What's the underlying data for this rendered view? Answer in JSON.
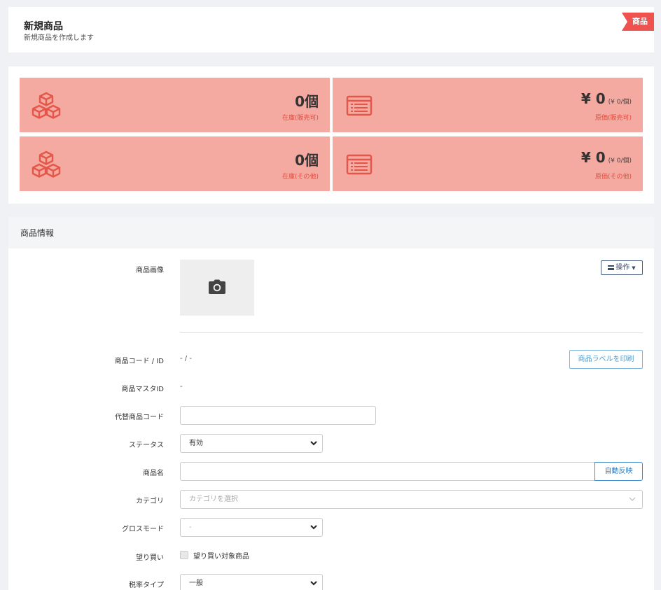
{
  "header": {
    "title": "新規商品",
    "subtitle": "新規商品を作成します",
    "ribbon": "商品"
  },
  "stats": [
    {
      "value": "0個",
      "unit_note": "",
      "label": "在庫(販売可)",
      "icon": "cubes-icon"
    },
    {
      "value": "¥ 0",
      "unit_note": "(¥ 0/個)",
      "label": "原価(販売可)",
      "icon": "card-list-icon"
    },
    {
      "value": "0個",
      "unit_note": "",
      "label": "在庫(その他)",
      "icon": "cubes-icon"
    },
    {
      "value": "¥ 0",
      "unit_note": "(¥ 0/個)",
      "label": "原価(その他)",
      "icon": "card-list-icon"
    }
  ],
  "colors": {
    "stat_bg": "#f4aaa0",
    "stat_label": "#e14c40",
    "ribbon": "#ef5350",
    "accent_blue": "#3d8ed1"
  },
  "info": {
    "heading": "商品情報",
    "image_label": "商品画像",
    "ops_button": "操作",
    "code_label": "商品コード / ID",
    "code_value": "- / -",
    "print_button": "商品ラベルを印刷",
    "master_label": "商品マスタID",
    "master_value": "-",
    "alt_code_label": "代替商品コード",
    "alt_code_value": "",
    "status_label": "ステータス",
    "status_value": "有効",
    "name_label": "商品名",
    "name_value": "",
    "auto_button": "自動反映",
    "category_label": "カテゴリ",
    "category_placeholder": "カテゴリを選択",
    "gross_label": "グロスモード",
    "gross_value": "-",
    "buy_label": "望り買い",
    "buy_checkbox_label": "望り買い対象商品",
    "tax_label": "税率タイプ",
    "tax_value": "一般"
  }
}
